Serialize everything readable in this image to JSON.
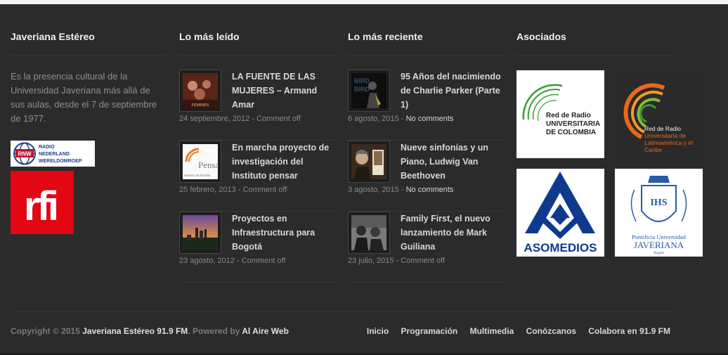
{
  "about": {
    "title": "Javeriana Estéreo",
    "text": "Es la presencia cultural de la Universidad Javeriana más allá de sus aulas, desde el 7 de septiembre de 1977.",
    "rnw_logo": [
      "RADIO",
      "NEDERLAND",
      "WERELDOMROEP"
    ],
    "rnw_badge": "RNW",
    "rfi_logo": "rfi"
  },
  "most_read": {
    "title": "Lo más leído",
    "posts": [
      {
        "title": "LA FUENTE DE LAS MUJERES – Armand Amar",
        "date": "24 septiembre, 2012",
        "comments": "Comment off",
        "thumb_label": "FEMMES"
      },
      {
        "title": "En marcha proyecto de investigación del Instituto pensar",
        "date": "25 febrero, 2013",
        "comments": "Comment off",
        "thumb_label": "Pensar"
      },
      {
        "title": "Proyectos en Infraestructura para Bogotá",
        "date": "23 agosto, 2012",
        "comments": "Comment off"
      }
    ]
  },
  "recent": {
    "title": "Lo más reciente",
    "posts": [
      {
        "title": "95 Años del nacimiendo de Charlie Parker (Parte 1)",
        "date": "6 agosto, 2015",
        "comments": "No comments"
      },
      {
        "title": "Nueve sinfonías y un Piano, Ludwig Van Beethoven",
        "date": "3 agosto, 2015",
        "comments": "No comments"
      },
      {
        "title": "Family First, el nuevo lanzamiento de Mark Guiliana",
        "date": "23 julio, 2015",
        "comments": "Comment off"
      }
    ]
  },
  "partners": {
    "title": "Asociados",
    "logos": [
      {
        "name": "Red de Radio Universitaria de Colombia",
        "lines": [
          "Red de Radio",
          "UNIVERSITARIA",
          "DE COLOMBIA"
        ]
      },
      {
        "name": "Red de Radio Universitaria de Latinoamérica y el Caribe",
        "lines": [
          "Red de Radio",
          "Universitaria de",
          "Latinoamérica y el",
          "Caribe"
        ]
      },
      {
        "name": "ASOMEDIOS",
        "lines": [
          "ASOMEDIOS"
        ]
      },
      {
        "name": "Pontificia Universidad Javeriana",
        "lines": [
          "Pontificia Universidad",
          "JAVERIANA",
          "Bogotá"
        ]
      }
    ]
  },
  "footer": {
    "copyright_prefix": "Copyright © 2015",
    "copyright_site": "Javeriana Estéreo 91.9 FM",
    "powered_prefix": ". Powered by",
    "powered_by": "Al Aire Web",
    "nav": [
      "Inicio",
      "Programación",
      "Multimedia",
      "Conózcanos",
      "Colabora en 91.9 FM"
    ]
  },
  "colors": {
    "background": "#2b2b2b",
    "rfi_red": "#e30613",
    "rnw_blue": "#1a3f8f",
    "asomedios_blue": "#0d3a8c",
    "rru_orange": "#e8671c",
    "rru_green": "#3a9a3a"
  }
}
